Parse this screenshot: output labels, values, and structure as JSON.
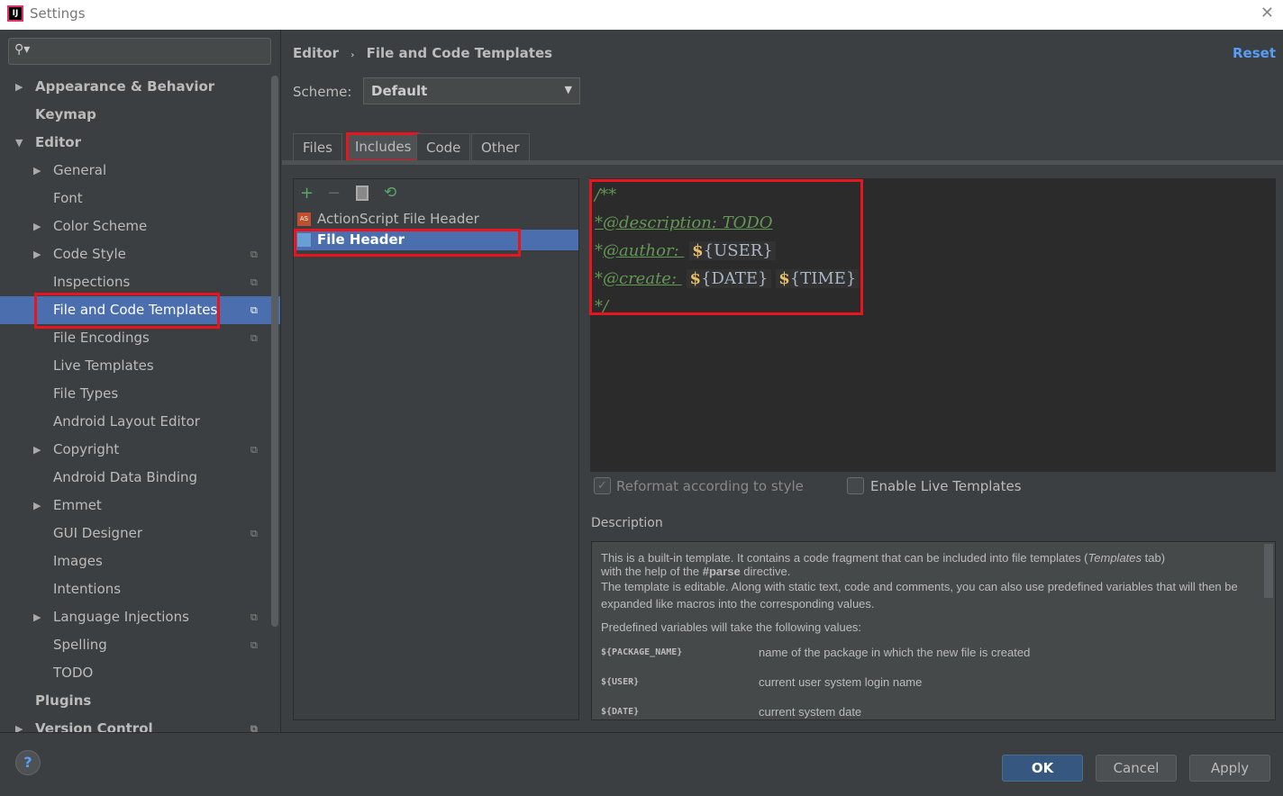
{
  "window": {
    "title": "Settings"
  },
  "search": {
    "placeholder": ""
  },
  "sidebar": {
    "items": [
      {
        "label": "Appearance & Behavior",
        "level": 0,
        "arrow": "▶",
        "bold": true
      },
      {
        "label": "Keymap",
        "level": 0,
        "arrow": "",
        "bold": true
      },
      {
        "label": "Editor",
        "level": 0,
        "arrow": "▼",
        "bold": true
      },
      {
        "label": "General",
        "level": 1,
        "arrow": "▶"
      },
      {
        "label": "Font",
        "level": 1,
        "arrow": ""
      },
      {
        "label": "Color Scheme",
        "level": 1,
        "arrow": "▶"
      },
      {
        "label": "Code Style",
        "level": 1,
        "arrow": "▶",
        "copy": true
      },
      {
        "label": "Inspections",
        "level": 1,
        "arrow": "",
        "copy": true
      },
      {
        "label": "File and Code Templates",
        "level": 1,
        "arrow": "",
        "copy": true,
        "selected": true
      },
      {
        "label": "File Encodings",
        "level": 1,
        "arrow": "",
        "copy": true
      },
      {
        "label": "Live Templates",
        "level": 1,
        "arrow": ""
      },
      {
        "label": "File Types",
        "level": 1,
        "arrow": ""
      },
      {
        "label": "Android Layout Editor",
        "level": 1,
        "arrow": ""
      },
      {
        "label": "Copyright",
        "level": 1,
        "arrow": "▶",
        "copy": true
      },
      {
        "label": "Android Data Binding",
        "level": 1,
        "arrow": ""
      },
      {
        "label": "Emmet",
        "level": 1,
        "arrow": "▶"
      },
      {
        "label": "GUI Designer",
        "level": 1,
        "arrow": "",
        "copy": true
      },
      {
        "label": "Images",
        "level": 1,
        "arrow": ""
      },
      {
        "label": "Intentions",
        "level": 1,
        "arrow": ""
      },
      {
        "label": "Language Injections",
        "level": 1,
        "arrow": "▶",
        "copy": true
      },
      {
        "label": "Spelling",
        "level": 1,
        "arrow": "",
        "copy": true
      },
      {
        "label": "TODO",
        "level": 1,
        "arrow": ""
      },
      {
        "label": "Plugins",
        "level": 0,
        "arrow": "",
        "bold": true
      },
      {
        "label": "Version Control",
        "level": 0,
        "arrow": "▶",
        "bold": true,
        "copy": true
      }
    ]
  },
  "header": {
    "crumb1": "Editor",
    "sep": "›",
    "crumb2": "File and Code Templates",
    "reset": "Reset"
  },
  "scheme": {
    "label": "Scheme:",
    "value": "Default"
  },
  "tabs": [
    "Files",
    "Includes",
    "Code",
    "Other"
  ],
  "toolbar": {
    "add": "+",
    "remove": "−",
    "copy": "copy-icon",
    "reset": "reset-icon"
  },
  "templates": [
    {
      "name": "ActionScript File Header",
      "icon": "AS"
    },
    {
      "name": "File Header",
      "selected": true
    }
  ],
  "editor": {
    "l1": "/**",
    "l2": "*@description: TODO",
    "l3a": "*",
    "l3b": "@author: ",
    "l4a": "*",
    "l4b": "@create: ",
    "l5": "*/",
    "dollar": "$",
    "user": "{USER}",
    "date": "{DATE}",
    "time": "{TIME}"
  },
  "options": {
    "reformat": "Reformat according to style",
    "reformat_checked": true,
    "live": "Enable Live Templates",
    "live_checked": false
  },
  "description": {
    "label": "Description",
    "p1a": "This is a built-in template. It contains a code fragment that can be included into file templates (",
    "p1b": "Templates",
    "p1c": " tab)",
    "p2a": "with the help of the ",
    "p2b": "#parse",
    "p2c": " directive.",
    "p3": "The template is editable. Along with static text, code and comments, you can also use predefined variables that will then be expanded like macros into the corresponding values.",
    "p4": "Predefined variables will take the following values:",
    "vars": [
      {
        "k": "${PACKAGE_NAME}",
        "v": "name of the package in which the new file is created"
      },
      {
        "k": "${USER}",
        "v": "current user system login name"
      },
      {
        "k": "${DATE}",
        "v": "current system date"
      }
    ]
  },
  "buttons": {
    "help": "?",
    "ok": "OK",
    "cancel": "Cancel",
    "apply": "Apply"
  },
  "colors": {
    "accent": "#4b6eaf",
    "link": "#589df6",
    "highlight": "#e8141e",
    "comment": "#629755"
  }
}
